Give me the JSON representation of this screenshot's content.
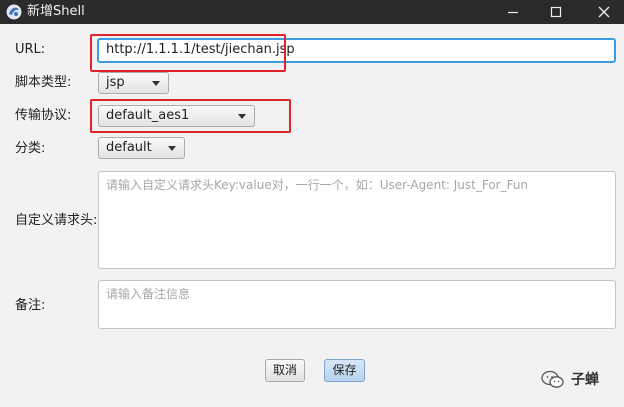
{
  "window": {
    "title": "新增Shell"
  },
  "form": {
    "url_label": "URL:",
    "url_value": "http://1.1.1.1/test/jiechan.jsp",
    "script_type_label": "脚本类型:",
    "script_type_value": "jsp",
    "protocol_label": "传输协议:",
    "protocol_value": "default_aes1",
    "category_label": "分类:",
    "category_value": "default",
    "headers_label": "自定义请求头:",
    "headers_placeholder": "请输入自定义请求头Key:value对，一行一个，如：User-Agent: Just_For_Fun",
    "notes_label": "备注:",
    "notes_placeholder": "请输入备注信息"
  },
  "buttons": {
    "cancel": "取消",
    "save": "保存"
  },
  "watermark": {
    "text": "子蝉"
  },
  "colors": {
    "highlight": "#e3232a",
    "focus": "#3c9ee0",
    "titlebar": "#2b2b2b"
  }
}
